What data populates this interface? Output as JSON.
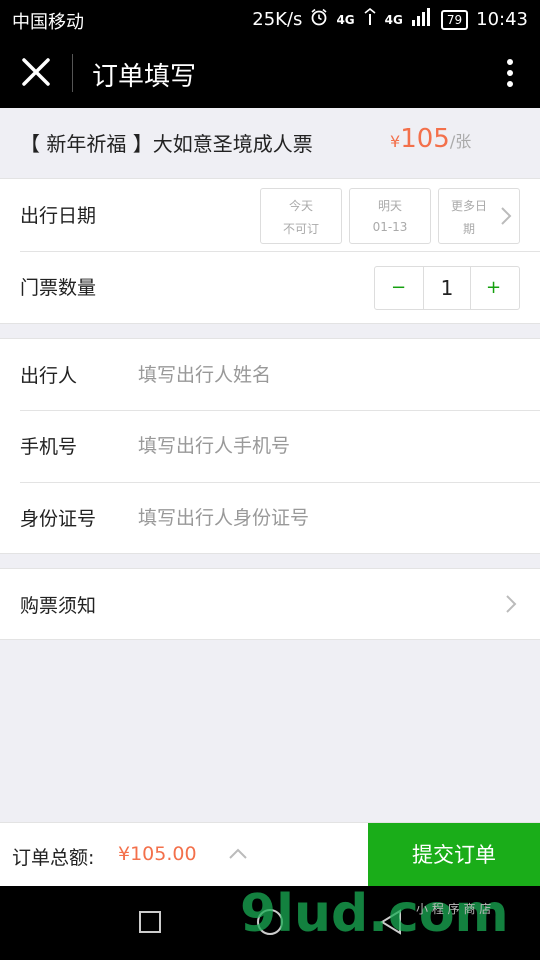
{
  "status_bar": {
    "carrier": "中国移动",
    "speed": "25K/s",
    "network": "4G",
    "network2": "4G",
    "battery": "79",
    "time": "10:43"
  },
  "nav": {
    "title": "订单填写"
  },
  "product": {
    "name": "【 新年祈福 】大如意圣境成人票",
    "currency": "¥",
    "price": "105",
    "unit": "/张"
  },
  "date": {
    "label": "出行日期",
    "options": [
      {
        "line1": "今天",
        "line2": "不可订"
      },
      {
        "line1": "明天",
        "line2": "01-13"
      },
      {
        "line1": "更多日",
        "line2": "期"
      }
    ]
  },
  "quantity": {
    "label": "门票数量",
    "minus": "−",
    "value": "1",
    "plus": "+"
  },
  "traveler": {
    "name_label": "出行人",
    "name_placeholder": "填写出行人姓名",
    "phone_label": "手机号",
    "phone_placeholder": "填写出行人手机号",
    "id_label": "身份证号",
    "id_placeholder": "填写出行人身份证号"
  },
  "notice": {
    "label": "购票须知"
  },
  "footer": {
    "total_label": "订单总额:",
    "total_value": "¥105.00",
    "submit_label": "提交订单"
  },
  "watermark": {
    "text": "9lud.com",
    "tagline": "小 程 序 商 店"
  }
}
